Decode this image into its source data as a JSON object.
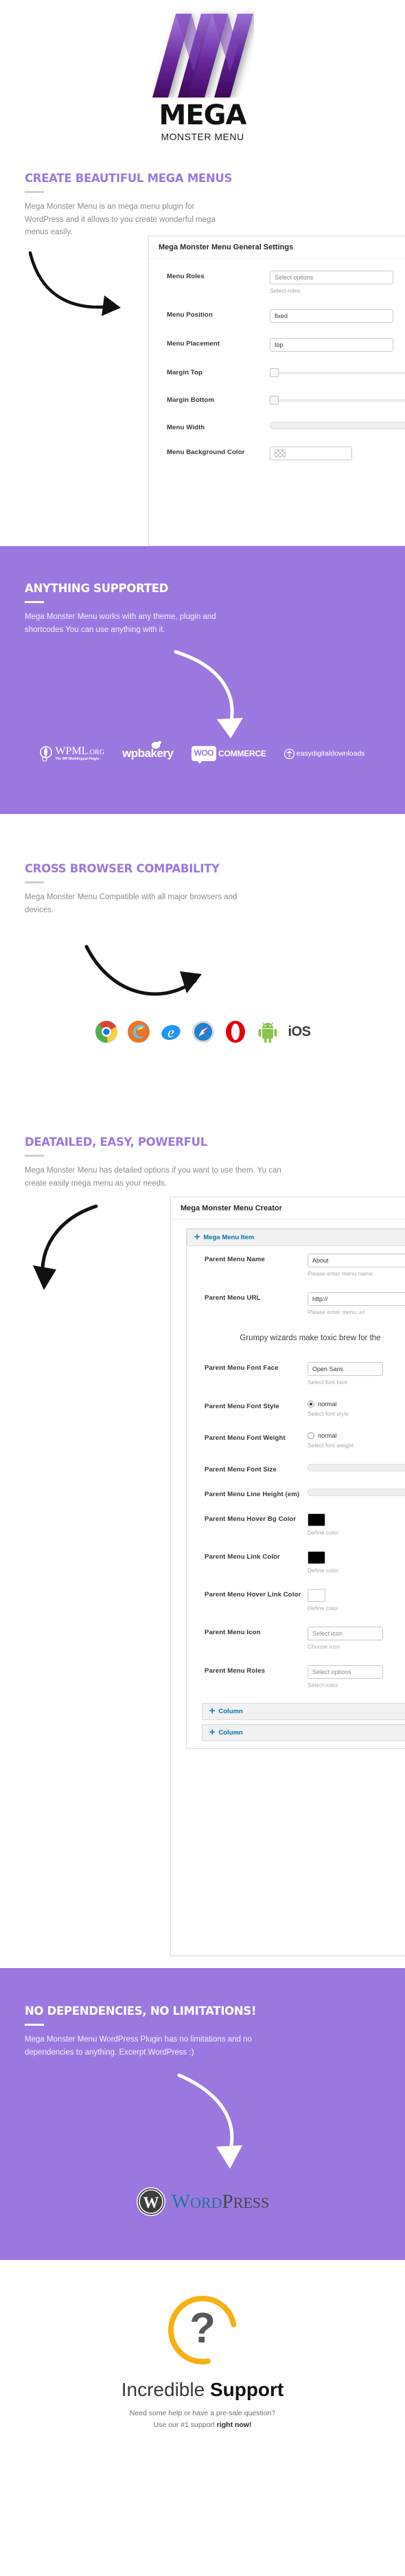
{
  "brand": {
    "logo_icon": "mega-m-logo",
    "name": "MEGA",
    "tagline": "MONSTER MENU",
    "accent_purple": "#9b78e0",
    "logo_purple_light": "#9b6fd6",
    "logo_purple_dark": "#4b0a6e"
  },
  "sections": [
    {
      "title": "CREATE BEAUTIFUL MEGA MENUS",
      "desc": "Mega Monster Menu is an mega menu plugin for WordPress and it allows to you create wonderful mega menus easily."
    },
    {
      "title": "ANYTHING SUPPORTED",
      "desc": "Mega Monster Menu works with any theme, plugin and shortcodes You can use anything with it."
    },
    {
      "title": "CROSS BROWSER COMPABILITY",
      "desc": "Mega Monster Menu Compatible with all major browsers and devices."
    },
    {
      "title": "DEATAILED, EASY, POWERFUL",
      "desc": "Mega Monster Menu has detailed options if you want to use them. Yu can create easily mega menu as your needs."
    },
    {
      "title": "NO DEPENDENCIES, NO LIMITATIONS!",
      "desc": "Mega Monster Menu WordPress Plugin has no limitations and no dependencies to anything.  Excerpt WordPress :)"
    }
  ],
  "general_settings_panel": {
    "title": "Mega Monster Menu General Settings",
    "rows": [
      {
        "label": "Menu Roles",
        "type": "select",
        "value": "Select options",
        "hint": "Select roles"
      },
      {
        "label": "Menu Position",
        "type": "select",
        "value": "fixed",
        "hint": ""
      },
      {
        "label": "Menu Placement",
        "type": "select",
        "value": "top",
        "hint": ""
      },
      {
        "label": "Margin Top",
        "type": "slider",
        "value": "",
        "hint": ""
      },
      {
        "label": "Margin Bottom",
        "type": "slider",
        "value": "",
        "hint": ""
      },
      {
        "label": "Menu Width",
        "type": "pill",
        "value": "",
        "hint": ""
      },
      {
        "label": "Menu Background Color",
        "type": "color",
        "value": "",
        "hint": ""
      }
    ]
  },
  "menu_creator_panel": {
    "title": "Mega Monster Menu Creator",
    "item_bar_label": "Mega Menu Item",
    "preview_text": "Grumpy wizards make toxic brew for the",
    "column_label": "Column",
    "columns": [
      "Column",
      "Column"
    ],
    "rows": [
      {
        "label": "Parent Menu Name",
        "type": "text",
        "value": "About",
        "hint": "Please enter menu name"
      },
      {
        "label": "Parent Menu URL",
        "type": "text",
        "value": "http://",
        "hint": "Please enter menu url"
      },
      {
        "label": "Parent Menu Font Face",
        "type": "select",
        "value": "Open Sans",
        "hint": "Select font face"
      },
      {
        "label": "Parent Menu Font Style",
        "type": "radio",
        "value": "normal",
        "hint": "Select font style",
        "checked": true
      },
      {
        "label": "Parent Menu Font Weight",
        "type": "radio",
        "value": "normal",
        "hint": "Select font weight",
        "checked": false
      },
      {
        "label": "Parent Menu Font Size",
        "type": "pill",
        "value": "",
        "hint": ""
      },
      {
        "label": "Parent Menu Line Height (em)",
        "type": "pill",
        "value": "",
        "hint": ""
      },
      {
        "label": "Parent Menu Hover Bg Color",
        "type": "color",
        "value": "#000000",
        "hint": "Define color"
      },
      {
        "label": "Parent Menu Link Color",
        "type": "color",
        "value": "#000000",
        "hint": "Define color"
      },
      {
        "label": "Parent Menu Hover Link Color",
        "type": "color",
        "value": "",
        "hint": "Define color"
      },
      {
        "label": "Parent Menu Icon",
        "type": "select",
        "value": "Select icon",
        "hint": "Choose icon"
      },
      {
        "label": "Parent Menu Roles",
        "type": "select",
        "value": "Select options",
        "hint": "Select roles"
      }
    ]
  },
  "supported_logos": [
    {
      "name": "wpml-logo",
      "text": "WPML",
      "sub": ".ORG",
      "caption": "The WP Multilingual Plugin"
    },
    {
      "name": "wpbakery-logo",
      "text": "wpbakery"
    },
    {
      "name": "woocommerce-logo",
      "text": "WOO",
      "sub": "COMMERCE"
    },
    {
      "name": "easy-digital-downloads-logo",
      "text": "easydigitaldownloads"
    }
  ],
  "browsers": [
    {
      "name": "chrome-icon",
      "label": "Chrome"
    },
    {
      "name": "firefox-icon",
      "label": "Firefox"
    },
    {
      "name": "internet-explorer-icon",
      "label": "Internet Explorer"
    },
    {
      "name": "safari-icon",
      "label": "Safari"
    },
    {
      "name": "opera-icon",
      "label": "Opera"
    },
    {
      "name": "android-icon",
      "label": "Android"
    },
    {
      "name": "ios-icon",
      "label": "iOS"
    }
  ],
  "wordpress_logo": {
    "name": "wordpress-logo",
    "text_w": "W",
    "text_ord": "ORD",
    "text_p": "P",
    "text_ress": "RESS"
  },
  "support": {
    "icon": "question-headset-icon",
    "title_thin": "Incredible ",
    "title_bold": "Support",
    "line1": "Need some help or have a pre-sale question?",
    "line2_pre": "Use our #1 support ",
    "line2_bold": "right now!"
  }
}
